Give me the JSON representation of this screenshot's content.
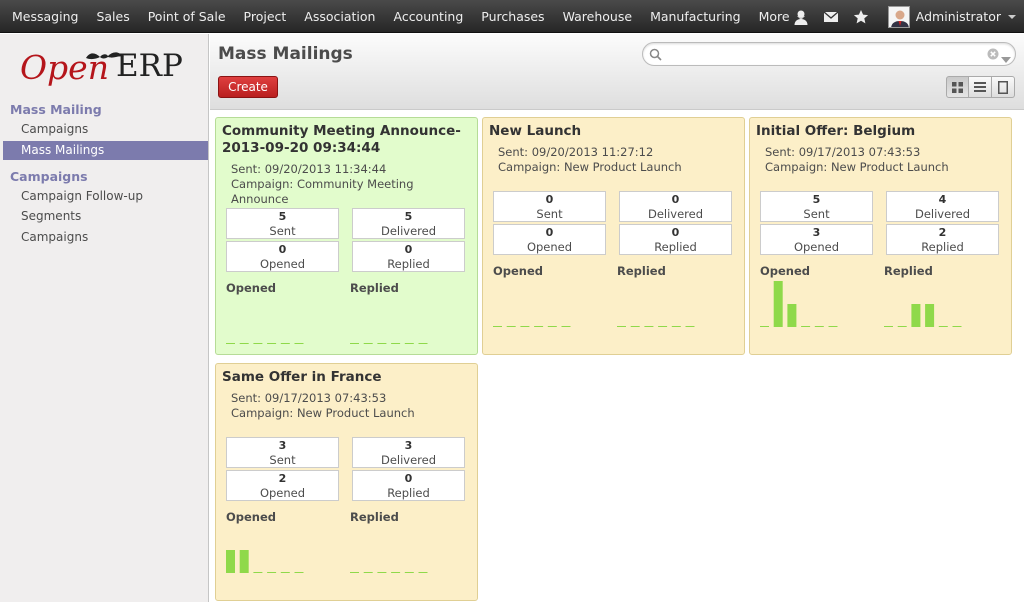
{
  "topbar": {
    "menu": [
      "Messaging",
      "Sales",
      "Point of Sale",
      "Project",
      "Association",
      "Accounting",
      "Purchases",
      "Warehouse",
      "Manufacturing",
      "More"
    ],
    "user": "Administrator"
  },
  "sidebar": {
    "logo": {
      "part1": "Open",
      "part2": "ERP"
    },
    "section1": "Mass Mailing",
    "section1_items": [
      "Campaigns",
      "Mass Mailings"
    ],
    "section2": "Campaigns",
    "section2_items": [
      "Campaign Follow-up",
      "Segments",
      "Campaigns"
    ],
    "active_item": "Mass Mailings"
  },
  "header": {
    "title": "Mass Mailings",
    "create_label": "Create",
    "search_value": ""
  },
  "colors": {
    "accent": "#7c7bad",
    "create": "#c62828",
    "bar": "#8fd94a",
    "green_card": "#e2fccc",
    "yellow_card": "#fcefc8"
  },
  "stat_labels": {
    "sent": "Sent",
    "delivered": "Delivered",
    "opened": "Opened",
    "replied": "Replied"
  },
  "graph_labels": {
    "opened": "Opened",
    "replied": "Replied"
  },
  "cards": [
    {
      "title": "Community Meeting Announce-2013-09-20 09:34:44",
      "sent": "Sent:  09/20/2013 11:34:44",
      "campaign": "Campaign: Community Meeting Announce",
      "stats": {
        "sent": "5",
        "delivered": "5",
        "opened": "0",
        "replied": "0"
      },
      "color": "green",
      "opened_series": [
        0,
        0,
        0,
        0,
        0,
        0
      ],
      "replied_series": [
        0,
        0,
        0,
        0,
        0,
        0
      ]
    },
    {
      "title": "New Launch",
      "sent": "Sent:  09/20/2013 11:27:12",
      "campaign": "Campaign: New Product Launch",
      "stats": {
        "sent": "0",
        "delivered": "0",
        "opened": "0",
        "replied": "0"
      },
      "color": "yellow",
      "opened_series": [
        0,
        0,
        0,
        0,
        0,
        0
      ],
      "replied_series": [
        0,
        0,
        0,
        0,
        0,
        0
      ]
    },
    {
      "title": "Initial Offer: Belgium",
      "sent": "Sent:  09/17/2013 07:43:53",
      "campaign": "Campaign: New Product Launch",
      "stats": {
        "sent": "5",
        "delivered": "4",
        "opened": "3",
        "replied": "2"
      },
      "color": "yellow",
      "opened_series": [
        0,
        2,
        1,
        0,
        0,
        0
      ],
      "replied_series": [
        0,
        0,
        1,
        1,
        0,
        0
      ]
    },
    {
      "title": "Same Offer in France",
      "sent": "Sent:  09/17/2013 07:43:53",
      "campaign": "Campaign: New Product Launch",
      "stats": {
        "sent": "3",
        "delivered": "3",
        "opened": "2",
        "replied": "0"
      },
      "color": "yellow",
      "opened_series": [
        1,
        1,
        0,
        0,
        0,
        0
      ],
      "replied_series": [
        0,
        0,
        0,
        0,
        0,
        0
      ]
    }
  ]
}
